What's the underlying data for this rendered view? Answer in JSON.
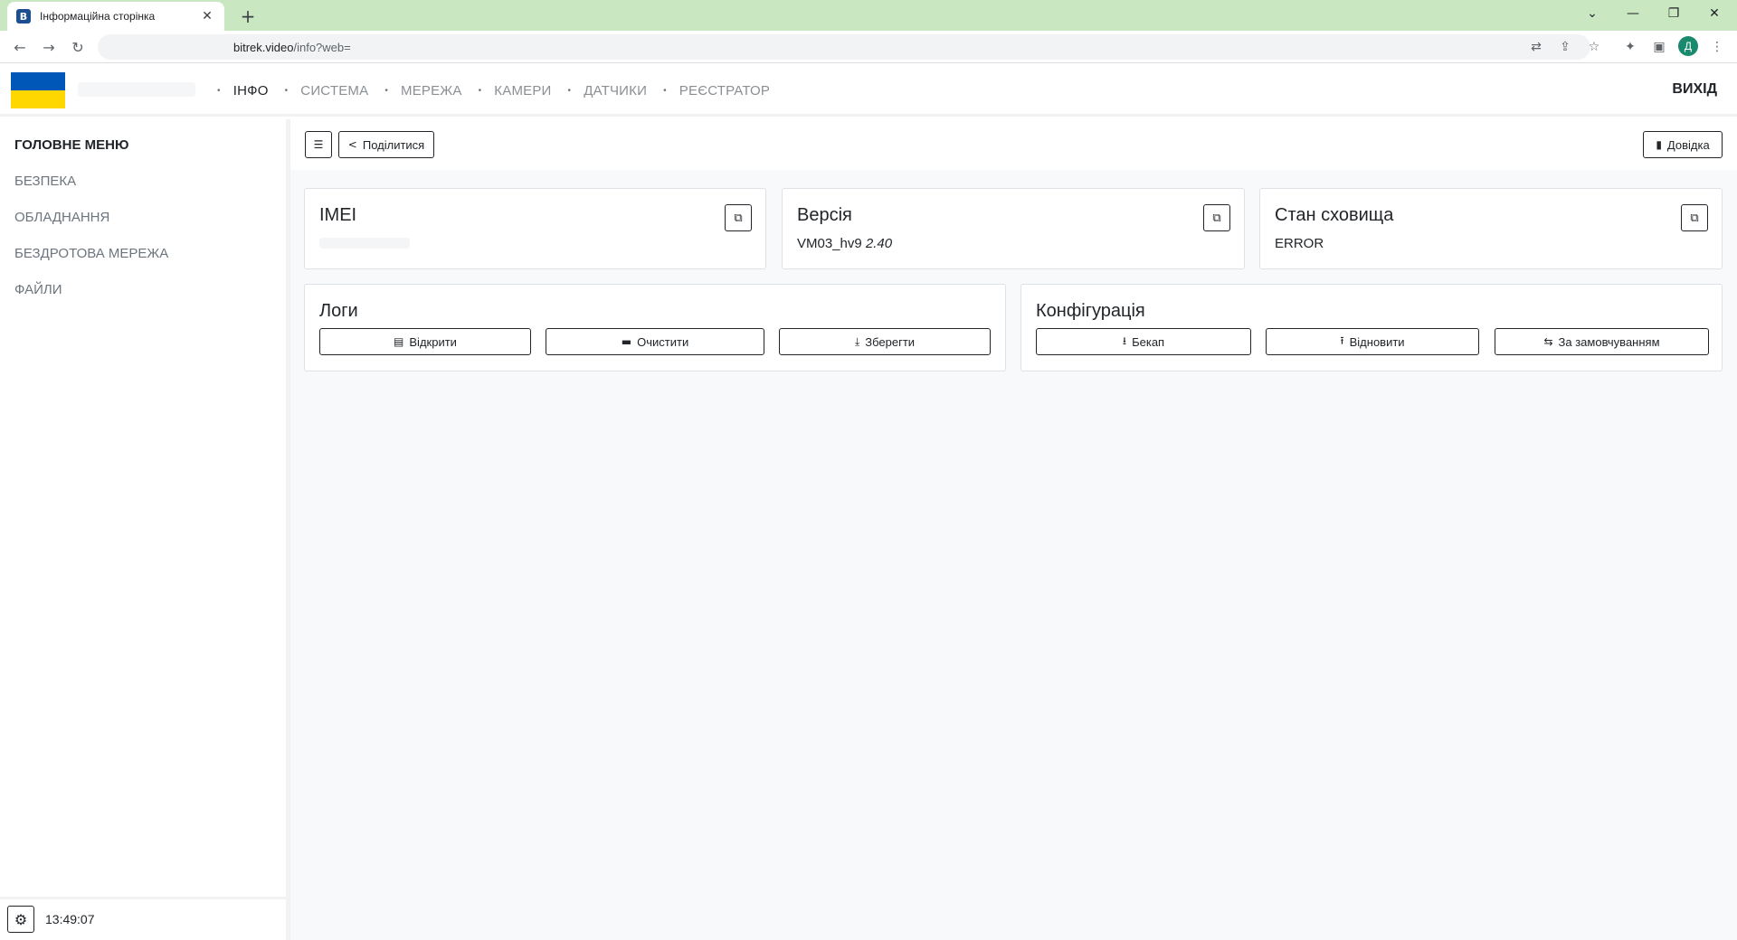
{
  "browser": {
    "tab_title": "Інформаційна сторінка",
    "tab_favicon": "B",
    "url_host": "bitrek.video",
    "url_path": "/info?web=",
    "profile_initial": "Д"
  },
  "header": {
    "nav": [
      {
        "label": "ІНФО",
        "active": true
      },
      {
        "label": "СИСТЕМА",
        "active": false
      },
      {
        "label": "МЕРЕЖА",
        "active": false
      },
      {
        "label": "КАМЕРИ",
        "active": false
      },
      {
        "label": "ДАТЧИКИ",
        "active": false
      },
      {
        "label": "РЕЄСТРАТОР",
        "active": false
      }
    ],
    "logout_label": "ВИХІД"
  },
  "sidebar": {
    "title": "ГОЛОВНЕ МЕНЮ",
    "items": [
      {
        "label": "БЕЗПЕКА"
      },
      {
        "label": "ОБЛАДНАННЯ"
      },
      {
        "label": "БЕЗДРОТОВА МЕРЕЖА"
      },
      {
        "label": "ФАЙЛИ"
      }
    ],
    "clock": "13:49:07"
  },
  "toolbar": {
    "share_label": "Поділитися",
    "help_label": "Довідка"
  },
  "cards": {
    "imei": {
      "title": "IMEI",
      "value": ""
    },
    "version": {
      "title": "Версія",
      "value": "VM03_hv9",
      "value_italic": "2.40"
    },
    "storage": {
      "title": "Стан сховища",
      "value": "ERROR"
    }
  },
  "logs": {
    "title": "Логи",
    "open_label": "Відкрити",
    "clear_label": "Очистити",
    "save_label": "Зберегти"
  },
  "config": {
    "title": "Конфігурація",
    "backup_label": "Бекап",
    "restore_label": "Відновити",
    "default_label": "За замовчуванням"
  },
  "colors": {
    "tabbar_bg": "#c9e8c1",
    "flag_blue": "#0057b7",
    "flag_yellow": "#ffd700",
    "avatar_bg": "#1a8a6e"
  }
}
